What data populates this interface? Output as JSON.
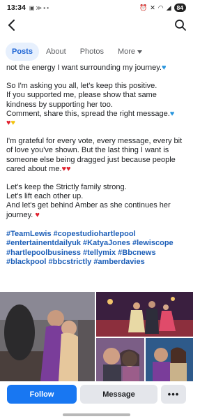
{
  "status_bar": {
    "time": "13:34",
    "battery": "84"
  },
  "tabs": [
    {
      "label": "Posts"
    },
    {
      "label": "About"
    },
    {
      "label": "Photos"
    },
    {
      "label": "More"
    }
  ],
  "post": {
    "lines_1": "not the energy I want surrounding my journey.",
    "p2_a": "So I'm asking you all, let's keep this positive.",
    "p2_b": "If you supported me, please show that same kindness by supporting her too.",
    "p2_c": "Comment, share this, spread the right message.",
    "p3": "I'm grateful for every vote, every message, every bit of love you've shown. But the last thing I want is someone else being dragged just because people cared about me.",
    "p4_a": "Let's keep the Strictly family strong.",
    "p4_b": "Let's lift each other up.",
    "p4_c": "And let's get behind Amber as she continues her journey.",
    "hashtags": "#TeamLewis #copestudiohartlepool #entertainentdailyuk #KatyaJones #lewiscope #hartlepoolbusiness #tellymix #Bbcnews #blackpool #bbcstrictly #amberdavies"
  },
  "actions": {
    "follow": "Follow",
    "message": "Message",
    "more": "•••"
  },
  "colors": {
    "accent": "#1877f2",
    "hashtag": "#1d5fb8",
    "active_tab_bg": "#e7f0fd"
  }
}
